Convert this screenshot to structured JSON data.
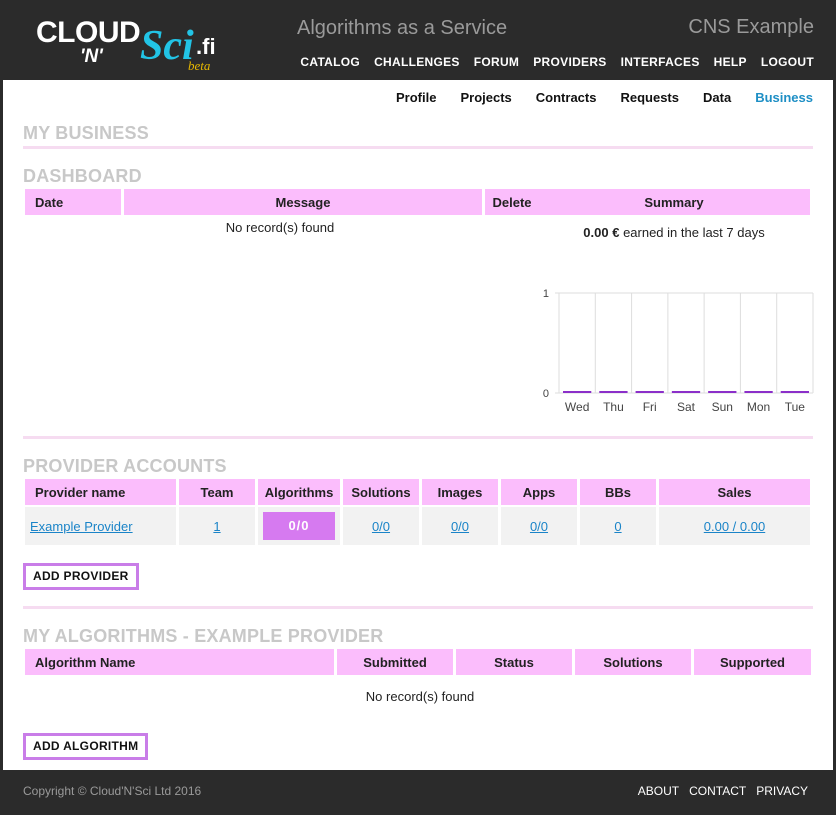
{
  "header": {
    "logo": {
      "cloud": "CLOUD",
      "n": "'N'",
      "sci": "Sci",
      "fi": ".fi",
      "beta": "beta"
    },
    "tagline": "Algorithms as a Service",
    "site_name": "CNS Example",
    "nav": [
      "CATALOG",
      "CHALLENGES",
      "FORUM",
      "PROVIDERS",
      "INTERFACES",
      "HELP",
      "LOGOUT"
    ]
  },
  "subnav": {
    "items": [
      "Profile",
      "Projects",
      "Contracts",
      "Requests",
      "Data",
      "Business"
    ],
    "active": "Business"
  },
  "page_title": "MY BUSINESS",
  "dashboard": {
    "title": "DASHBOARD",
    "columns": [
      "Date",
      "Message",
      "Delete"
    ],
    "empty_text": "No record(s) found",
    "summary_header": "Summary",
    "summary_amount": "0.00 €",
    "summary_text": "earned in the last 7 days"
  },
  "chart_data": {
    "type": "bar",
    "categories": [
      "Wed",
      "Thu",
      "Fri",
      "Sat",
      "Sun",
      "Mon",
      "Tue"
    ],
    "values": [
      0,
      0,
      0,
      0,
      0,
      0,
      0
    ],
    "ylim": [
      0,
      1
    ],
    "yticks": [
      "0",
      "1"
    ],
    "grid": true,
    "bar_color": "#8b2fc9"
  },
  "provider_accounts": {
    "title": "PROVIDER ACCOUNTS",
    "columns": [
      "Provider name",
      "Team",
      "Algorithms",
      "Solutions",
      "Images",
      "Apps",
      "BBs",
      "Sales"
    ],
    "rows": [
      {
        "name": "Example Provider",
        "team": "1",
        "algorithms": "0/0",
        "solutions": "0/0",
        "images": "0/0",
        "apps": "0/0",
        "bbs": "0",
        "sales": "0.00 / 0.00"
      }
    ],
    "add_button": "ADD PROVIDER"
  },
  "my_algorithms": {
    "title": "MY ALGORITHMS - EXAMPLE PROVIDER",
    "columns": [
      "Algorithm Name",
      "Submitted",
      "Status",
      "Solutions",
      "Supported"
    ],
    "empty_text": "No record(s) found",
    "add_button": "ADD ALGORITHM"
  },
  "footer": {
    "copyright": "Copyright © Cloud'N'Sci Ltd 2016",
    "links": [
      "ABOUT",
      "CONTACT",
      "PRIVACY"
    ]
  },
  "colors": {
    "accent_pink": "#fbbdfc",
    "button_border": "#c97de8",
    "link_blue": "#1a84c8",
    "active_nav": "#1e8fc5"
  }
}
